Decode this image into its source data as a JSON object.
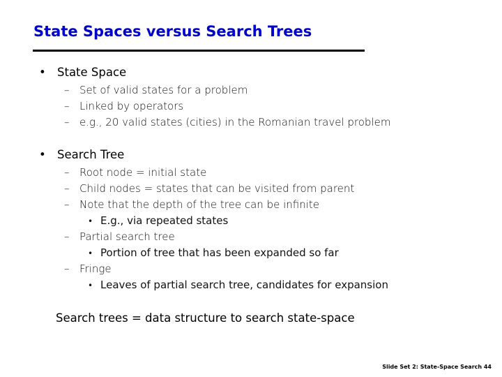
{
  "slide": {
    "title": "State Spaces versus Search Trees",
    "bullet_glyph": "•",
    "dash_glyph": "–",
    "sections": [
      {
        "heading": "State Space",
        "items": [
          {
            "text": "Set of valid states for a problem"
          },
          {
            "text": "Linked by operators"
          },
          {
            "text": "e.g., 20 valid states (cities) in the Romanian travel problem"
          }
        ]
      },
      {
        "heading": "Search Tree",
        "items": [
          {
            "text": "Root node = initial state"
          },
          {
            "text": "Child nodes = states that can be visited from parent"
          },
          {
            "text": "Note that the depth of the tree can be infinite",
            "sub": [
              "E.g., via repeated states"
            ]
          },
          {
            "text": "Partial search tree",
            "sub": [
              "Portion of tree that has been expanded so far"
            ]
          },
          {
            "text": "Fringe",
            "sub": [
              "Leaves of partial search tree, candidates for expansion"
            ]
          }
        ]
      }
    ],
    "summary": "Search trees = data structure to search state-space",
    "footer": "Slide Set 2: State-Space Search 44",
    "title_color": "#0000cc"
  }
}
